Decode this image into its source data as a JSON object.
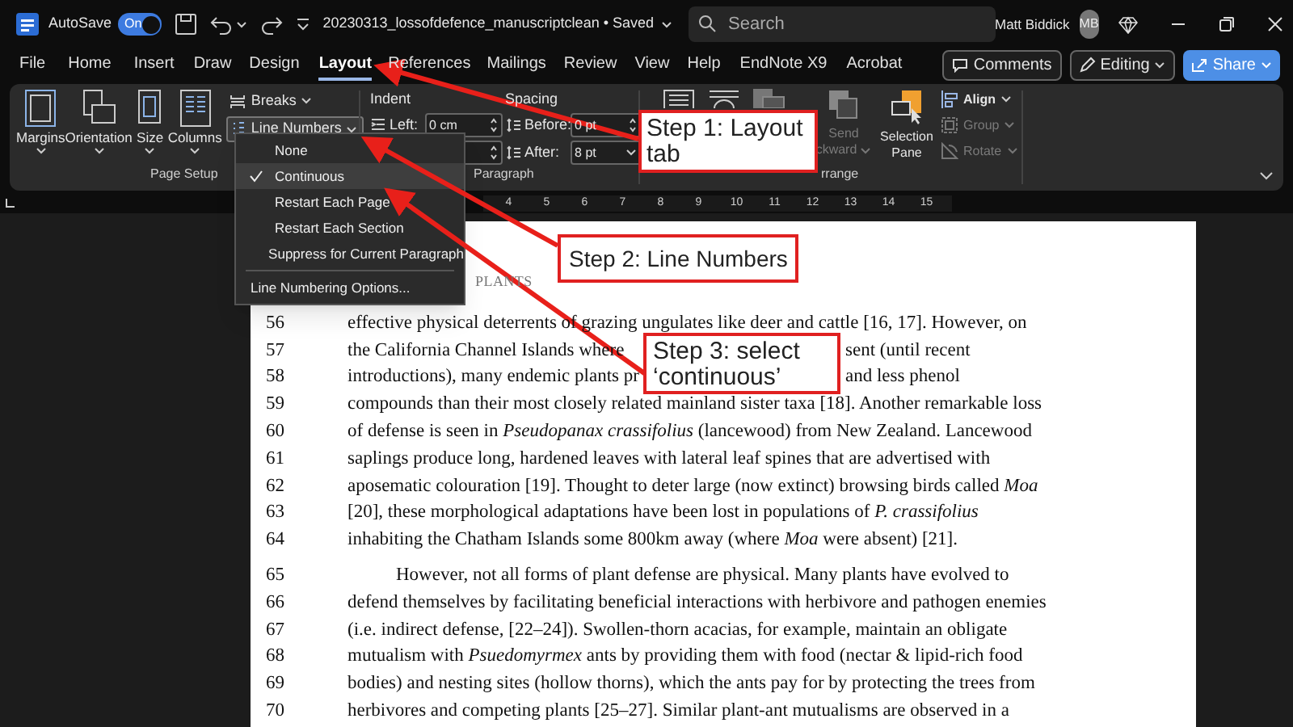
{
  "title_bar": {
    "autosave_label": "AutoSave",
    "autosave": {
      "on": true,
      "label": "On"
    },
    "document_title": "20230313_lossofdefence_manuscriptclean • Saved",
    "search": {
      "placeholder": "Search"
    },
    "user_name": "Matt Biddick",
    "avatar_initials": "MB"
  },
  "tabs": [
    {
      "label": "File",
      "selected": false
    },
    {
      "label": "Home",
      "selected": false
    },
    {
      "label": "Insert",
      "selected": false
    },
    {
      "label": "Draw",
      "selected": false
    },
    {
      "label": "Design",
      "selected": false
    },
    {
      "label": "Layout",
      "selected": true
    },
    {
      "label": "References",
      "selected": false
    },
    {
      "label": "Mailings",
      "selected": false
    },
    {
      "label": "Review",
      "selected": false
    },
    {
      "label": "View",
      "selected": false
    },
    {
      "label": "Help",
      "selected": false
    },
    {
      "label": "EndNote X9",
      "selected": false
    },
    {
      "label": "Acrobat",
      "selected": false
    }
  ],
  "header_buttons": [
    {
      "label": "Comments",
      "kind": "plain"
    },
    {
      "label": "Editing",
      "kind": "dropdown"
    },
    {
      "label": "Share",
      "kind": "primary"
    }
  ],
  "ribbon": {
    "page_setup": {
      "buttons": [
        {
          "label": "Margins",
          "kind": "margins"
        },
        {
          "label": "Orientation",
          "kind": "orientation"
        },
        {
          "label": "Size",
          "kind": "size"
        },
        {
          "label": "Columns",
          "kind": "columns"
        }
      ],
      "breaks": "Breaks",
      "line_numbers": "Line Numbers",
      "label": "Page Setup"
    },
    "indent": {
      "label": "Indent",
      "left_label": "Left:",
      "left_value": "0 cm"
    },
    "spacing": {
      "label": "Spacing",
      "before_label": "Before:",
      "before_value": "0 pt",
      "after_label": "After:",
      "after_value": "8 pt"
    },
    "paragraph_label": "Paragraph",
    "arrange": {
      "send_backward": {
        "lines": [
          "Send",
          "ckward"
        ],
        "disabled": true
      },
      "selection_pane": {
        "lines": [
          "Selection",
          "Pane"
        ]
      },
      "small_buttons": [
        {
          "label": "Align",
          "disabled": false,
          "kind": "align"
        },
        {
          "label": "Group",
          "disabled": true,
          "kind": "group"
        },
        {
          "label": "Rotate",
          "disabled": true,
          "kind": "rotate"
        }
      ],
      "label": "rrange"
    }
  },
  "line_numbers_menu": {
    "items": [
      {
        "label": "None",
        "checked": false,
        "selected": false
      },
      {
        "label": "Continuous",
        "checked": true,
        "selected": true
      },
      {
        "label": "Restart Each Page",
        "checked": false,
        "selected": false
      },
      {
        "label": "Restart Each Section",
        "checked": false,
        "selected": false
      },
      {
        "label": "Suppress for Current Paragraph",
        "checked": false,
        "selected": false
      }
    ],
    "options_item": "Line Numbering Options..."
  },
  "ruler_numbers": [
    "4",
    "5",
    "6",
    "7",
    "8",
    "9",
    "10",
    "11",
    "12",
    "13",
    "14",
    "15"
  ],
  "document": {
    "heading": "PLANTS",
    "lines": [
      {
        "number": "56",
        "text": "effective physical deterrents of grazing ungulates like deer and cattle [16, 17]. However, on",
        "paragraph_start": false
      },
      {
        "number": "57",
        "text": "the California Channel Islands where",
        "text_after": "sent (until recent",
        "paragraph_start": false
      },
      {
        "number": "58",
        "text": "introductions), many endemic plants pr",
        "text_after": "and less phenol",
        "paragraph_start": false
      },
      {
        "number": "59",
        "text": "compounds than their most closely related mainland sister taxa [18]. Another remarkable loss",
        "paragraph_start": false
      },
      {
        "number": "60",
        "text": "of defense is seen in *Pseudopanax crassifolius* (lancewood) from New Zealand. Lancewood",
        "paragraph_start": false
      },
      {
        "number": "61",
        "text": "saplings produce long, hardened leaves with lateral leaf spines that are advertised with",
        "paragraph_start": false
      },
      {
        "number": "62",
        "text": "aposematic colouration [19]. Thought to deter large (now extinct) browsing birds called *Moa*",
        "paragraph_start": false
      },
      {
        "number": "63",
        "text": "[20], these morphological adaptations have been lost in populations of *P. crassifolius*",
        "paragraph_start": false
      },
      {
        "number": "64",
        "text": "inhabiting the Chatham Islands some 800km away (where *Moa* were absent) [21].",
        "paragraph_start": false
      },
      {
        "number": "65",
        "text": "However, not all forms of plant defense are physical. Many plants have evolved to",
        "paragraph_start": true
      },
      {
        "number": "66",
        "text": "defend themselves by facilitating beneficial interactions with herbivore and pathogen enemies",
        "paragraph_start": false
      },
      {
        "number": "67",
        "text": "(i.e. indirect defense, [22–24]). Swollen-thorn acacias, for example, maintain an obligate",
        "paragraph_start": false
      },
      {
        "number": "68",
        "text": "mutualism with *Psuedomyrmex* ants by providing them with food (nectar & lipid-rich food",
        "paragraph_start": false
      },
      {
        "number": "69",
        "text": "bodies) and nesting sites (hollow thorns), which the ants pay for by protecting the trees from",
        "paragraph_start": false
      },
      {
        "number": "70",
        "text": "herbivores and competing plants [25–27]. Similar plant-ant mutualisms are observed in a",
        "paragraph_start": false
      }
    ]
  },
  "callouts": [
    {
      "text": "Step 1: Layout tab"
    },
    {
      "text": "Step 2: Line Numbers"
    },
    {
      "text": "Step 3: select ‘continuous’"
    }
  ]
}
